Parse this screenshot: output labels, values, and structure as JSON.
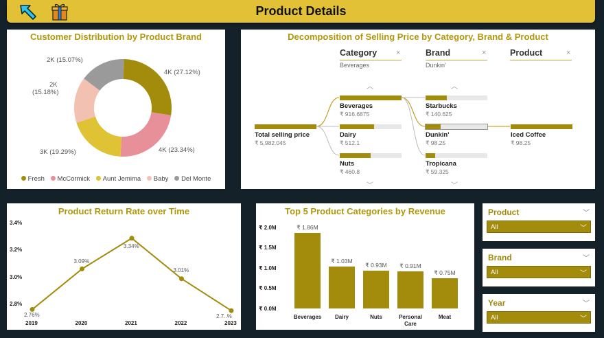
{
  "header": {
    "title": "Product Details",
    "back_icon": "back-arrow-icon",
    "gift_icon": "gift-icon"
  },
  "colors": {
    "gold": "#a38b0c",
    "header_bg": "#e3c136",
    "page_bg": "#142129"
  },
  "donut": {
    "title": "Customer Distribution by Product Brand",
    "labels": [
      "4K (27.12%)",
      "4K (23.34%)",
      "3K (19.29%)",
      "2K",
      "(15.18%)",
      "2K (15.07%)"
    ],
    "legend": [
      {
        "name": "Fresh",
        "color": "#a38b0c"
      },
      {
        "name": "McCormick",
        "color": "#e8909a"
      },
      {
        "name": "Aunt Jemima",
        "color": "#e0c235"
      },
      {
        "name": "Baby",
        "color": "#f3c1b1"
      },
      {
        "name": "Del Monte",
        "color": "#9a9a9a"
      }
    ]
  },
  "decomp": {
    "title": "Decomposition of Selling Price by Category, Brand & Product",
    "columns": [
      {
        "label": "Category",
        "filter": "Beverages"
      },
      {
        "label": "Brand",
        "filter": "Dunkin'"
      },
      {
        "label": "Product",
        "filter": ""
      }
    ],
    "close_glyph": "×",
    "root": {
      "name": "Total selling price",
      "value": "₹ 5,982.045"
    },
    "categories": [
      {
        "name": "Beverages",
        "value": "₹ 916.6875",
        "fill": 1.0
      },
      {
        "name": "Dairy",
        "value": "₹ 512.1",
        "fill": 0.56
      },
      {
        "name": "Nuts",
        "value": "₹ 460.8",
        "fill": 0.5
      }
    ],
    "brands": [
      {
        "name": "Starbucks",
        "value": "₹ 140.625",
        "fill": 0.34
      },
      {
        "name": "Dunkin'",
        "value": "₹ 98.25",
        "fill": 0.24
      },
      {
        "name": "Tropicana",
        "value": "₹ 59.325",
        "fill": 0.15
      }
    ],
    "products": [
      {
        "name": "Iced Coffee",
        "value": "₹ 98.25",
        "fill": 1.0
      }
    ]
  },
  "linechart": {
    "title": "Product Return Rate over Time",
    "ticks_y": [
      "3.4%",
      "3.2%",
      "3.0%",
      "2.8%"
    ],
    "point_labels": [
      "2.76%",
      "3.09%",
      "3.34%",
      "3.01%",
      "2.7..%"
    ],
    "chart_data": {
      "type": "line",
      "x": [
        "2019",
        "2020",
        "2021",
        "2022",
        "2023"
      ],
      "values": [
        2.76,
        3.09,
        3.34,
        3.01,
        2.75
      ],
      "ylim": [
        2.74,
        3.4
      ]
    }
  },
  "barchart": {
    "title": "Top 5 Product Categories by Revenue",
    "ticks_y": [
      "₹ 2.0M",
      "₹ 1.5M",
      "₹ 1.0M",
      "₹ 0.5M",
      "₹ 0.0M"
    ],
    "value_labels": [
      "₹ 1.86M",
      "₹ 1.03M",
      "₹ 0.93M",
      "₹ 0.91M",
      "₹ 0.75M"
    ],
    "chart_data": {
      "type": "bar",
      "categories": [
        "Beverages",
        "Dairy",
        "Nuts",
        "Personal Care",
        "Meat"
      ],
      "values": [
        1.86,
        1.03,
        0.93,
        0.91,
        0.75
      ],
      "ylim": [
        0,
        2.0
      ]
    }
  },
  "slicers": [
    {
      "title": "Product",
      "value": "All"
    },
    {
      "title": "Brand",
      "value": "All"
    },
    {
      "title": "Year",
      "value": "All"
    }
  ]
}
